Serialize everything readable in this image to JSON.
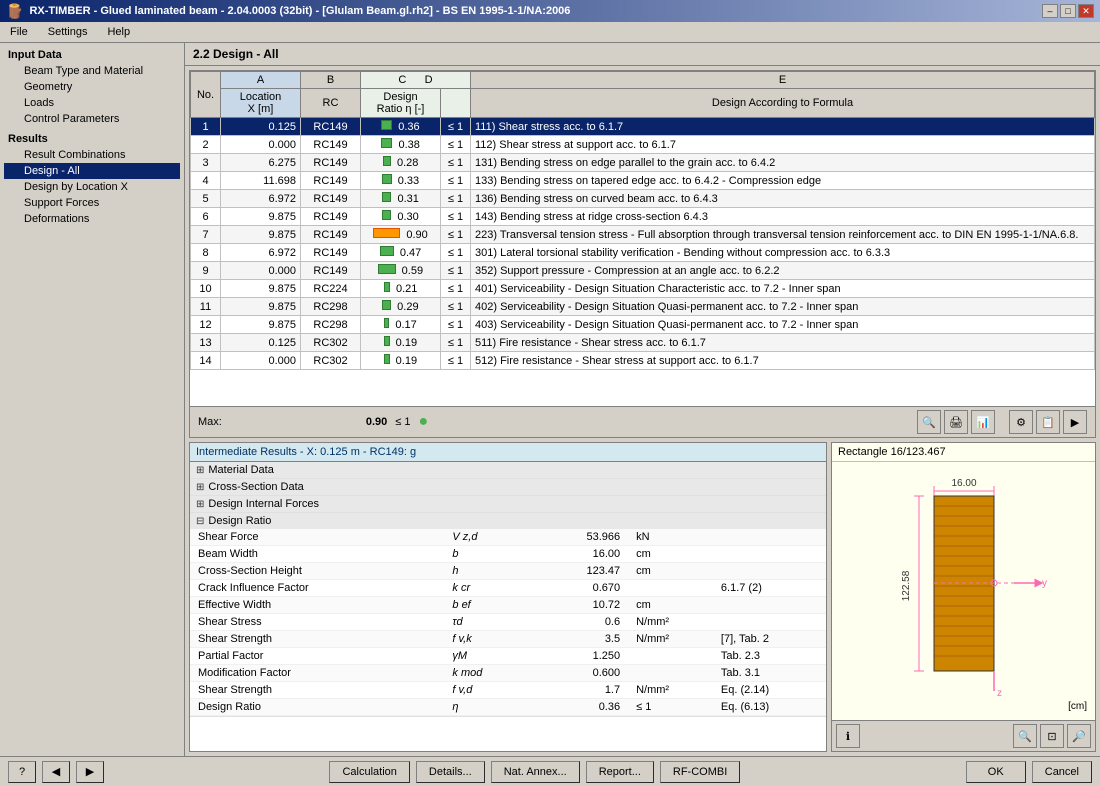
{
  "window": {
    "title": "RX-TIMBER - Glued laminated beam - 2.04.0003 (32bit) - [Glulam Beam.gl.rh2] - BS EN 1995-1-1/NA:2006",
    "close_label": "✕",
    "min_label": "–",
    "max_label": "□"
  },
  "menu": {
    "items": [
      "File",
      "Settings",
      "Help"
    ]
  },
  "sidebar": {
    "input_data_label": "Input Data",
    "items": [
      {
        "label": "Beam Type and Material",
        "active": false
      },
      {
        "label": "Geometry",
        "active": false
      },
      {
        "label": "Loads",
        "active": false
      },
      {
        "label": "Control Parameters",
        "active": false
      }
    ],
    "results_label": "Results",
    "result_items": [
      {
        "label": "Result Combinations",
        "active": false
      },
      {
        "label": "Design - All",
        "active": true
      },
      {
        "label": "Design by Location X",
        "active": false
      },
      {
        "label": "Support Forces",
        "active": false
      },
      {
        "label": "Deformations",
        "active": false
      }
    ]
  },
  "section_title": "2.2 Design - All",
  "table": {
    "col_headers": [
      "A",
      "B",
      "C",
      "D",
      "E"
    ],
    "sub_headers": [
      "No.",
      "Location X [m]",
      "RC",
      "Design Ratio η [-]",
      "",
      "Design According to Formula"
    ],
    "rows": [
      {
        "no": 1,
        "location": "0.125",
        "rc": "RC149",
        "ratio": "0.36",
        "le": "≤ 1",
        "formula": "111) Shear stress acc. to 6.1.7",
        "selected": true
      },
      {
        "no": 2,
        "location": "0.000",
        "rc": "RC149",
        "ratio": "0.38",
        "le": "≤ 1",
        "formula": "112) Shear stress at support acc. to 6.1.7"
      },
      {
        "no": 3,
        "location": "6.275",
        "rc": "RC149",
        "ratio": "0.28",
        "le": "≤ 1",
        "formula": "131) Bending stress on edge parallel to the grain acc. to 6.4.2"
      },
      {
        "no": 4,
        "location": "11.698",
        "rc": "RC149",
        "ratio": "0.33",
        "le": "≤ 1",
        "formula": "133) Bending stress on tapered edge acc. to 6.4.2 - Compression edge"
      },
      {
        "no": 5,
        "location": "6.972",
        "rc": "RC149",
        "ratio": "0.31",
        "le": "≤ 1",
        "formula": "136) Bending stress on curved beam acc. to 6.4.3"
      },
      {
        "no": 6,
        "location": "9.875",
        "rc": "RC149",
        "ratio": "0.30",
        "le": "≤ 1",
        "formula": "143) Bending stress at ridge cross-section 6.4.3"
      },
      {
        "no": 7,
        "location": "9.875",
        "rc": "RC149",
        "ratio": "0.90",
        "le": "≤ 1",
        "formula": "223) Transversal tension stress - Full absorption through transversal tension reinforcement acc. to DIN EN 1995-1-1/NA.6.8.",
        "highlight": true
      },
      {
        "no": 8,
        "location": "6.972",
        "rc": "RC149",
        "ratio": "0.47",
        "le": "≤ 1",
        "formula": "301) Lateral torsional stability verification - Bending without compression acc. to 6.3.3"
      },
      {
        "no": 9,
        "location": "0.000",
        "rc": "RC149",
        "ratio": "0.59",
        "le": "≤ 1",
        "formula": "352) Support pressure - Compression at an angle acc. to 6.2.2"
      },
      {
        "no": 10,
        "location": "9.875",
        "rc": "RC224",
        "ratio": "0.21",
        "le": "≤ 1",
        "formula": "401) Serviceability - Design Situation Characteristic acc. to 7.2 - Inner span"
      },
      {
        "no": 11,
        "location": "9.875",
        "rc": "RC298",
        "ratio": "0.29",
        "le": "≤ 1",
        "formula": "402) Serviceability - Design Situation Quasi-permanent acc. to 7.2 - Inner span"
      },
      {
        "no": 12,
        "location": "9.875",
        "rc": "RC298",
        "ratio": "0.17",
        "le": "≤ 1",
        "formula": "403) Serviceability - Design Situation Quasi-permanent acc. to 7.2 - Inner span"
      },
      {
        "no": 13,
        "location": "0.125",
        "rc": "RC302",
        "ratio": "0.19",
        "le": "≤ 1",
        "formula": "511) Fire resistance - Shear stress acc. to 6.1.7"
      },
      {
        "no": 14,
        "location": "0.000",
        "rc": "RC302",
        "ratio": "0.19",
        "le": "≤ 1",
        "formula": "512) Fire resistance - Shear stress at support acc. to 6.1.7"
      }
    ],
    "max_label": "Max:",
    "max_value": "0.90",
    "max_le": "≤ 1"
  },
  "intermediate": {
    "header": "Intermediate Results  -  X: 0.125 m  -  RC149: g",
    "sections": [
      {
        "label": "Material Data",
        "expanded": false
      },
      {
        "label": "Cross-Section Data",
        "expanded": false
      },
      {
        "label": "Design Internal Forces",
        "expanded": false
      },
      {
        "label": "Design Ratio",
        "expanded": true
      }
    ],
    "design_ratio_rows": [
      {
        "label": "Shear Force",
        "symbol": "V z,d",
        "value": "53.966",
        "unit": "kN",
        "ref": ""
      },
      {
        "label": "Beam Width",
        "symbol": "b",
        "value": "16.00",
        "unit": "cm",
        "ref": ""
      },
      {
        "label": "Cross-Section Height",
        "symbol": "h",
        "value": "123.47",
        "unit": "cm",
        "ref": ""
      },
      {
        "label": "Crack Influence Factor",
        "symbol": "k cr",
        "value": "0.670",
        "unit": "",
        "ref": "6.1.7 (2)"
      },
      {
        "label": "Effective Width",
        "symbol": "b ef",
        "value": "10.72",
        "unit": "cm",
        "ref": ""
      },
      {
        "label": "Shear Stress",
        "symbol": "τd",
        "value": "0.6",
        "unit": "N/mm²",
        "ref": ""
      },
      {
        "label": "Shear Strength",
        "symbol": "f v,k",
        "value": "3.5",
        "unit": "N/mm²",
        "ref": "[7], Tab. 2"
      },
      {
        "label": "Partial Factor",
        "symbol": "γM",
        "value": "1.250",
        "unit": "",
        "ref": "Tab. 2.3"
      },
      {
        "label": "Modification Factor",
        "symbol": "k mod",
        "value": "0.600",
        "unit": "",
        "ref": "Tab. 3.1"
      },
      {
        "label": "Shear Strength",
        "symbol": "f v,d",
        "value": "1.7",
        "unit": "N/mm²",
        "ref": "Eq. (2.14)"
      },
      {
        "label": "Design Ratio",
        "symbol": "η",
        "value": "0.36",
        "unit": "≤ 1",
        "ref": "Eq. (6.13)"
      }
    ]
  },
  "visualization": {
    "title": "Rectangle 16/123.467",
    "width_label": "16.00",
    "height_label": "122.58",
    "unit_label": "[cm]"
  },
  "bottom_buttons": {
    "calculation": "Calculation",
    "details": "Details...",
    "nat_annex": "Nat. Annex...",
    "report": "Report...",
    "rf_combi": "RF-COMBI",
    "ok": "OK",
    "cancel": "Cancel"
  }
}
